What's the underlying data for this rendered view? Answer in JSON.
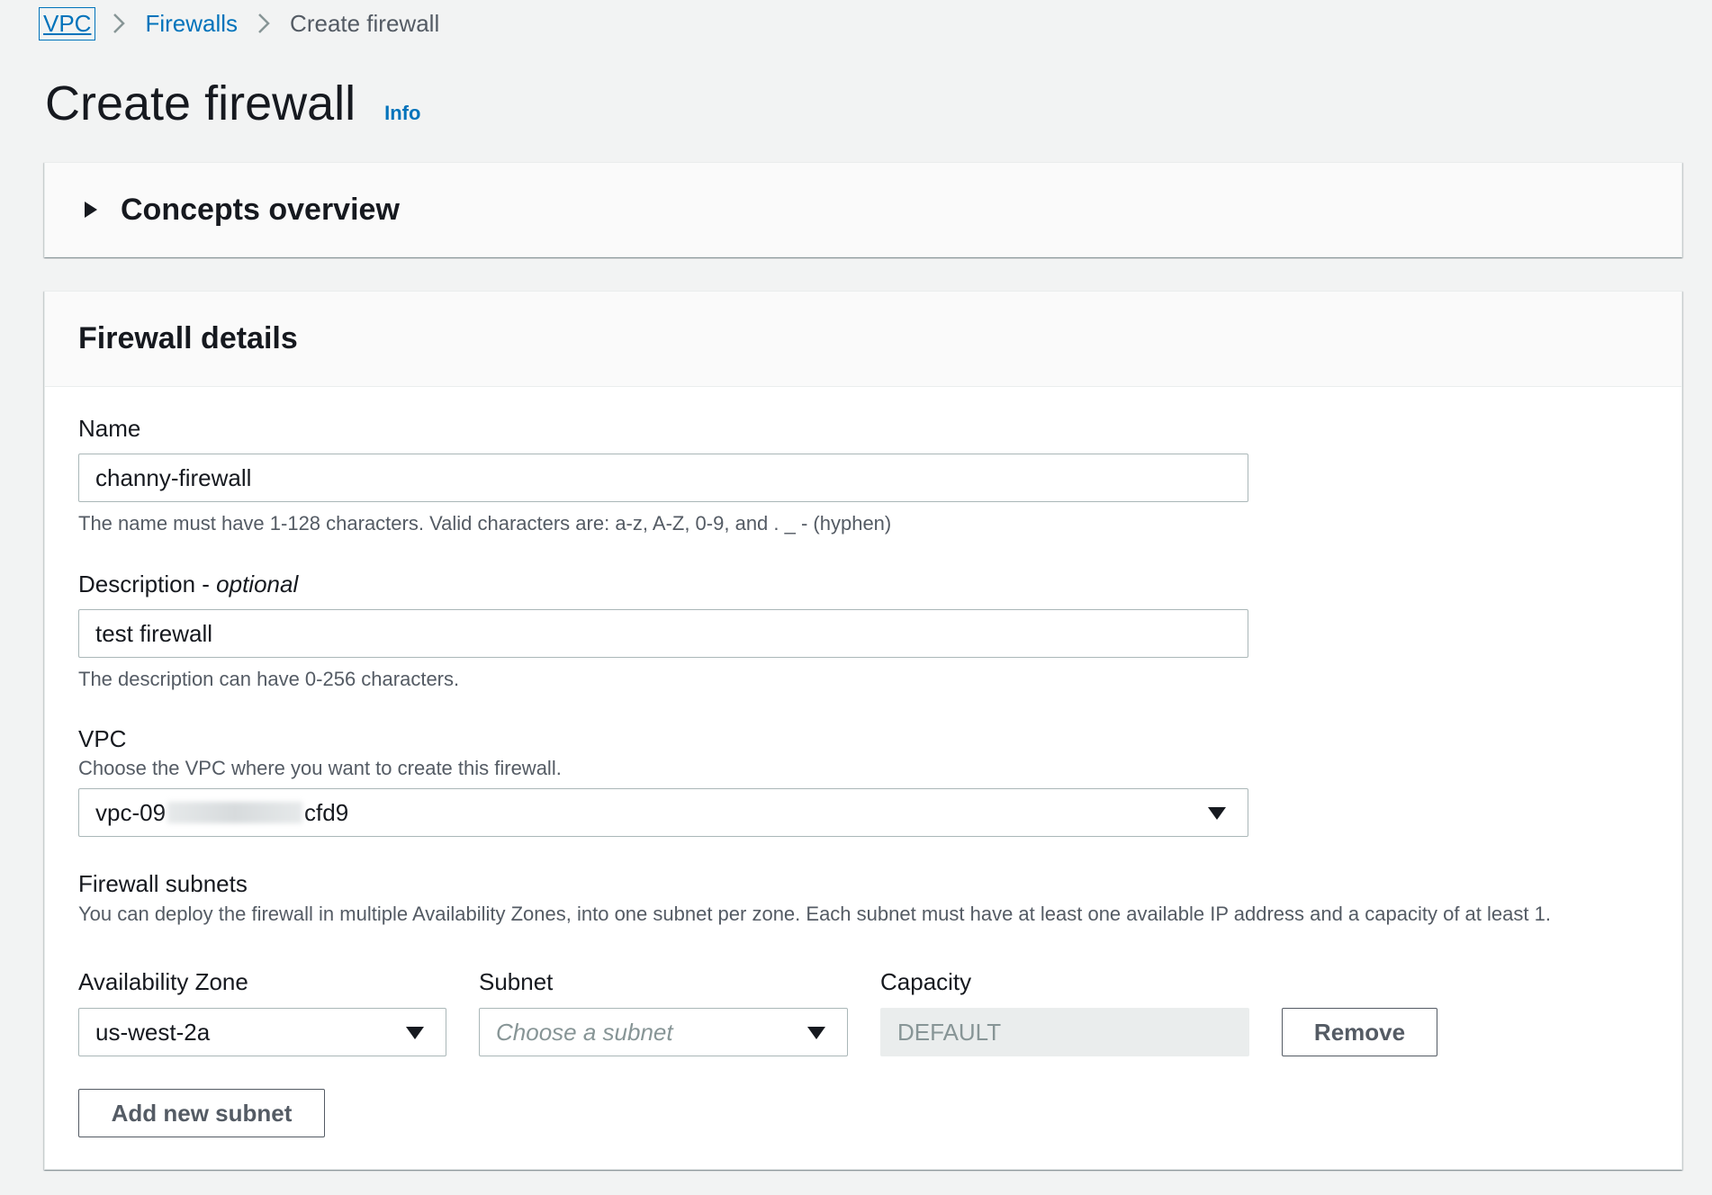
{
  "breadcrumb": {
    "items": [
      "VPC",
      "Firewalls"
    ],
    "current": "Create firewall"
  },
  "page": {
    "title": "Create firewall",
    "info": "Info"
  },
  "concepts": {
    "title": "Concepts overview"
  },
  "details": {
    "title": "Firewall details",
    "name": {
      "label": "Name",
      "value": "channy-firewall",
      "help": "The name must have 1-128 characters. Valid characters are: a-z, A-Z, 0-9, and . _ - (hyphen)"
    },
    "description": {
      "label": "Description - ",
      "optional": "optional",
      "value": "test firewall",
      "help": "The description can have 0-256 characters."
    },
    "vpc": {
      "label": "VPC",
      "help": "Choose the VPC where you want to create this firewall.",
      "value_prefix": "vpc-09",
      "value_suffix": "cfd9"
    },
    "subnets": {
      "label": "Firewall subnets",
      "help": "You can deploy the firewall in multiple Availability Zones, into one subnet per zone. Each subnet must have at least one available IP address and a capacity of at least 1.",
      "az_label": "Availability Zone",
      "az_value": "us-west-2a",
      "subnet_label": "Subnet",
      "subnet_placeholder": "Choose a subnet",
      "capacity_label": "Capacity",
      "capacity_value": "DEFAULT",
      "remove_label": "Remove",
      "add_label": "Add new subnet"
    }
  },
  "colors": {
    "link": "#0073bb",
    "background": "#f2f3f3",
    "text": "#16191f"
  }
}
